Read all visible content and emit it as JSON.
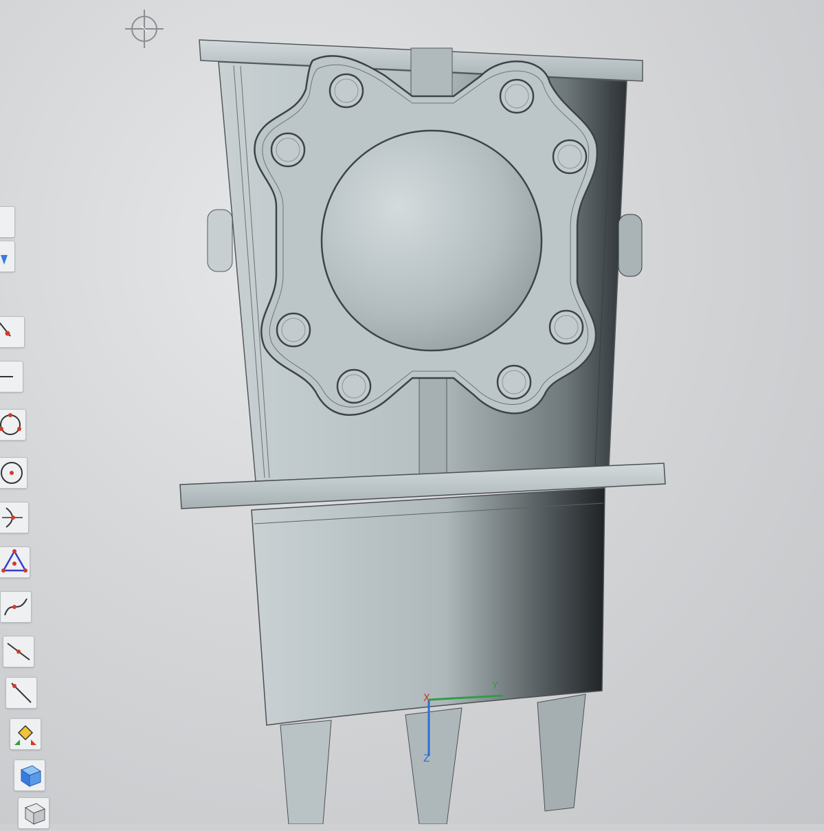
{
  "window": {
    "title_strip_text": ""
  },
  "viewport": {
    "background_color": "#cfd0d2",
    "model_color": "#b9c3c6",
    "model_shadow_color": "#2c3134",
    "axis_colors": {
      "x": "#c0392b",
      "y": "#2e9e45",
      "z": "#2b6fd6"
    }
  },
  "toolbar": {
    "tools": [
      {
        "name": "point-tool",
        "icon": "point-icon"
      },
      {
        "name": "line-tool",
        "icon": "line-icon"
      },
      {
        "name": "circle-three-point-tool",
        "icon": "circle-three-point-icon"
      },
      {
        "name": "circle-center-tool",
        "icon": "circle-center-icon"
      },
      {
        "name": "arc-tool",
        "icon": "arc-icon"
      },
      {
        "name": "triangle-tool",
        "icon": "triangle-icon"
      },
      {
        "name": "spline-tool",
        "icon": "spline-icon"
      },
      {
        "name": "line-segment-tool",
        "icon": "line-segment-icon"
      },
      {
        "name": "polyline-tool",
        "icon": "polyline-icon"
      },
      {
        "name": "constraint-tool",
        "icon": "constraint-icon"
      },
      {
        "name": "cube-blue-tool",
        "icon": "cube-blue-icon"
      },
      {
        "name": "cube-wire-tool",
        "icon": "cube-wire-icon"
      }
    ]
  },
  "triad": {
    "x_label": "X",
    "y_label": "Y",
    "z_label": "Z"
  }
}
